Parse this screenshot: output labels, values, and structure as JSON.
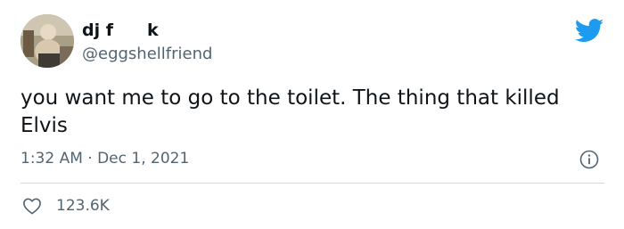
{
  "tweet": {
    "author": {
      "display_name": "dj f  k",
      "handle": "@eggshellfriend"
    },
    "text": "you want me to go to the toilet. The thing that killed Elvis",
    "timestamp": "1:32 AM · Dec 1, 2021",
    "likes": "123.6K"
  },
  "icons": {
    "brand": "twitter-bird-icon",
    "info": "info-icon",
    "like": "heart-icon"
  },
  "colors": {
    "brand_blue": "#1d9bf0",
    "text_primary": "#0f1419",
    "text_secondary": "#536471",
    "divider": "#cfd9de"
  }
}
